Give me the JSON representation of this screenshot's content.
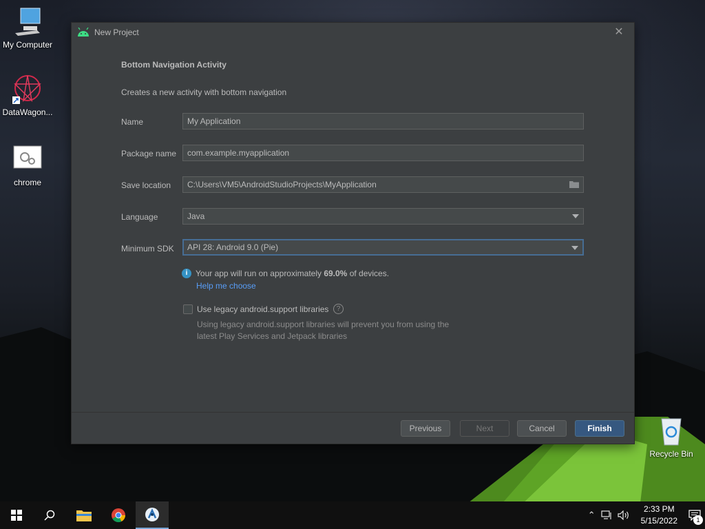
{
  "desktop": {
    "icons": [
      {
        "label": "My Computer"
      },
      {
        "label": "DataWagon..."
      },
      {
        "label": "chrome"
      },
      {
        "label": "Recycle Bin"
      }
    ]
  },
  "dialog": {
    "title": "New Project",
    "heading": "Bottom Navigation Activity",
    "description": "Creates a new activity with bottom navigation",
    "fields": {
      "name": {
        "label": "Name",
        "value": "My Application"
      },
      "package": {
        "label": "Package name",
        "value": "com.example.myapplication"
      },
      "location": {
        "label": "Save location",
        "value": "C:\\Users\\VM5\\AndroidStudioProjects\\MyApplication"
      },
      "language": {
        "label": "Language",
        "value": "Java"
      },
      "min_sdk": {
        "label": "Minimum SDK",
        "value": "API 28: Android 9.0 (Pie)"
      }
    },
    "info": {
      "prefix": "Your app will run on approximately ",
      "percent": "69.0%",
      "suffix": " of devices.",
      "help_link": "Help me choose"
    },
    "legacy": {
      "label": "Use legacy android.support libraries",
      "hint": "Using legacy android.support libraries will prevent you from using the latest Play Services and Jetpack libraries"
    },
    "buttons": {
      "previous": "Previous",
      "next": "Next",
      "cancel": "Cancel",
      "finish": "Finish"
    }
  },
  "taskbar": {
    "time": "2:33 PM",
    "date": "5/15/2022",
    "notification_count": "1"
  },
  "colors": {
    "dialog_bg": "#3c3f41",
    "field_bg": "#45494a",
    "link": "#589df6",
    "primary_button": "#365880",
    "focus_border": "#466d94"
  }
}
